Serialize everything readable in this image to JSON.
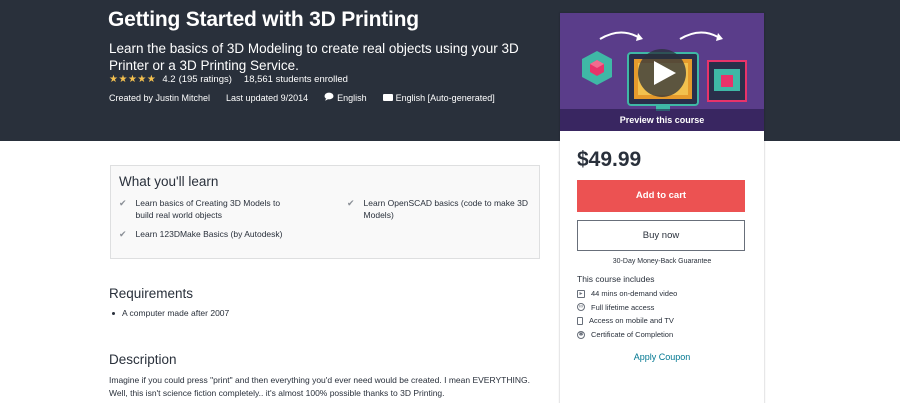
{
  "hero": {
    "title": "Getting Started with 3D Printing",
    "subtitle": "Learn the basics of 3D Modeling to create real objects using your 3D Printer or a 3D Printing Service.",
    "rating": "4.2",
    "ratings_count": "(195 ratings)",
    "students": "18,561 students enrolled",
    "created_by": "Created by Justin Mitchel",
    "last_updated": "Last updated 9/2014",
    "language": "English",
    "captions": "English [Auto-generated]",
    "star_color": "#f4c150",
    "background_color": "#29303b"
  },
  "card": {
    "preview_label": "Preview this course",
    "price": "$49.99",
    "add_to_cart": "Add to cart",
    "buy_now": "Buy now",
    "guarantee": "30-Day Money-Back Guarantee",
    "includes_heading": "This course includes",
    "includes": [
      {
        "icon": "video-icon",
        "label": "44 mins on-demand video"
      },
      {
        "icon": "infinity-icon",
        "label": "Full lifetime access"
      },
      {
        "icon": "mobile-icon",
        "label": "Access on mobile and TV"
      },
      {
        "icon": "certificate-icon",
        "label": "Certificate of Completion"
      }
    ],
    "apply_coupon": "Apply Coupon",
    "cart_button_color": "#ec5252",
    "link_color": "#007791"
  },
  "learn": {
    "title": "What you'll learn",
    "items": [
      "Learn basics of Creating 3D Models to build real world objects",
      "Learn OpenSCAD basics (code to make 3D Models)",
      "Learn 123DMake Basics (by Autodesk)"
    ]
  },
  "requirements": {
    "title": "Requirements",
    "items": [
      "A computer made after 2007"
    ]
  },
  "description": {
    "title": "Description",
    "text": "Imagine if you could press \"print\" and then everything you'd ever need would be created. I mean EVERYTHING. Well, this isn't science fiction completely.. it's almost 100% possible thanks to 3D Printing."
  }
}
